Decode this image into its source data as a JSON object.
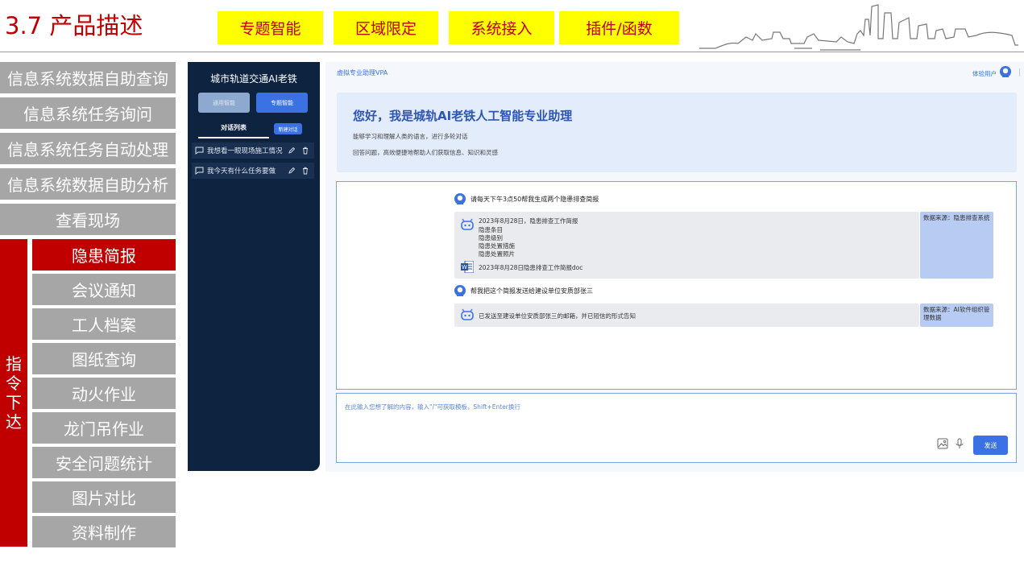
{
  "slide": {
    "title": "3.7 产品描述",
    "tags": [
      "专题智能",
      "区域限定",
      "系统接入",
      "插件/函数"
    ]
  },
  "menu": {
    "items": [
      "信息系统数据自助查询",
      "信息系统任务询问",
      "信息系统任务自动处理",
      "信息系统数据自助分析",
      "查看现场"
    ],
    "command_label": "指令下达",
    "sub_items": [
      "隐患简报",
      "会议通知",
      "工人档案",
      "图纸查询",
      "动火作业",
      "龙门吊作业",
      "安全问题统计",
      "图片对比",
      "资料制作"
    ],
    "selected_sub": "隐患简报"
  },
  "app": {
    "sidebar": {
      "title": "城市轨道交通AI老铁",
      "mode_general": "通用智能",
      "mode_topic": "专题智能",
      "conversations_label": "对话列表",
      "new_conversation": "新建对话",
      "conversations": [
        "我想看一眼现场施工情况",
        "我今天有什么任务要做"
      ]
    },
    "header": {
      "brand": "虚拟专业助理VPA",
      "user": "体验用户"
    },
    "welcome": {
      "title": "您好，我是城轨AI老铁人工智能专业助理",
      "line1": "能够学习和理解人类的语言，进行多轮对话",
      "line2": "回答问题，高效便捷地帮助人们获取信息、知识和灵感"
    },
    "chat": {
      "q1": "请每天下午3点50帮我生成两个隐患排查简报",
      "a1_lines": [
        "2023年8月28日，隐患排查工作简报",
        "隐患条目",
        "隐患级别",
        "隐患处置措施",
        "隐患处置照片"
      ],
      "a1_doc": "2023年8月28日隐患排查工作简报doc",
      "a1_source": "数据来源：隐患排查系统",
      "q2": "帮我把这个简报发送给建设单位安质部张三",
      "a2": "已发送至建设单位安质部张三的邮箱，并已短信的形式告知",
      "a2_source": "数据来源：AI软件组织管理数据"
    },
    "input": {
      "placeholder": "在此输入您想了解的内容，输入\"/\"可获取模板，Shift+Enter换行",
      "send": "发送"
    }
  },
  "colors": {
    "accent_red": "#c00000",
    "tag_yellow": "#ffff00",
    "menu_gray": "#a6a6a6",
    "sidebar_navy": "#0e2340",
    "primary_blue": "#3b72e3"
  }
}
